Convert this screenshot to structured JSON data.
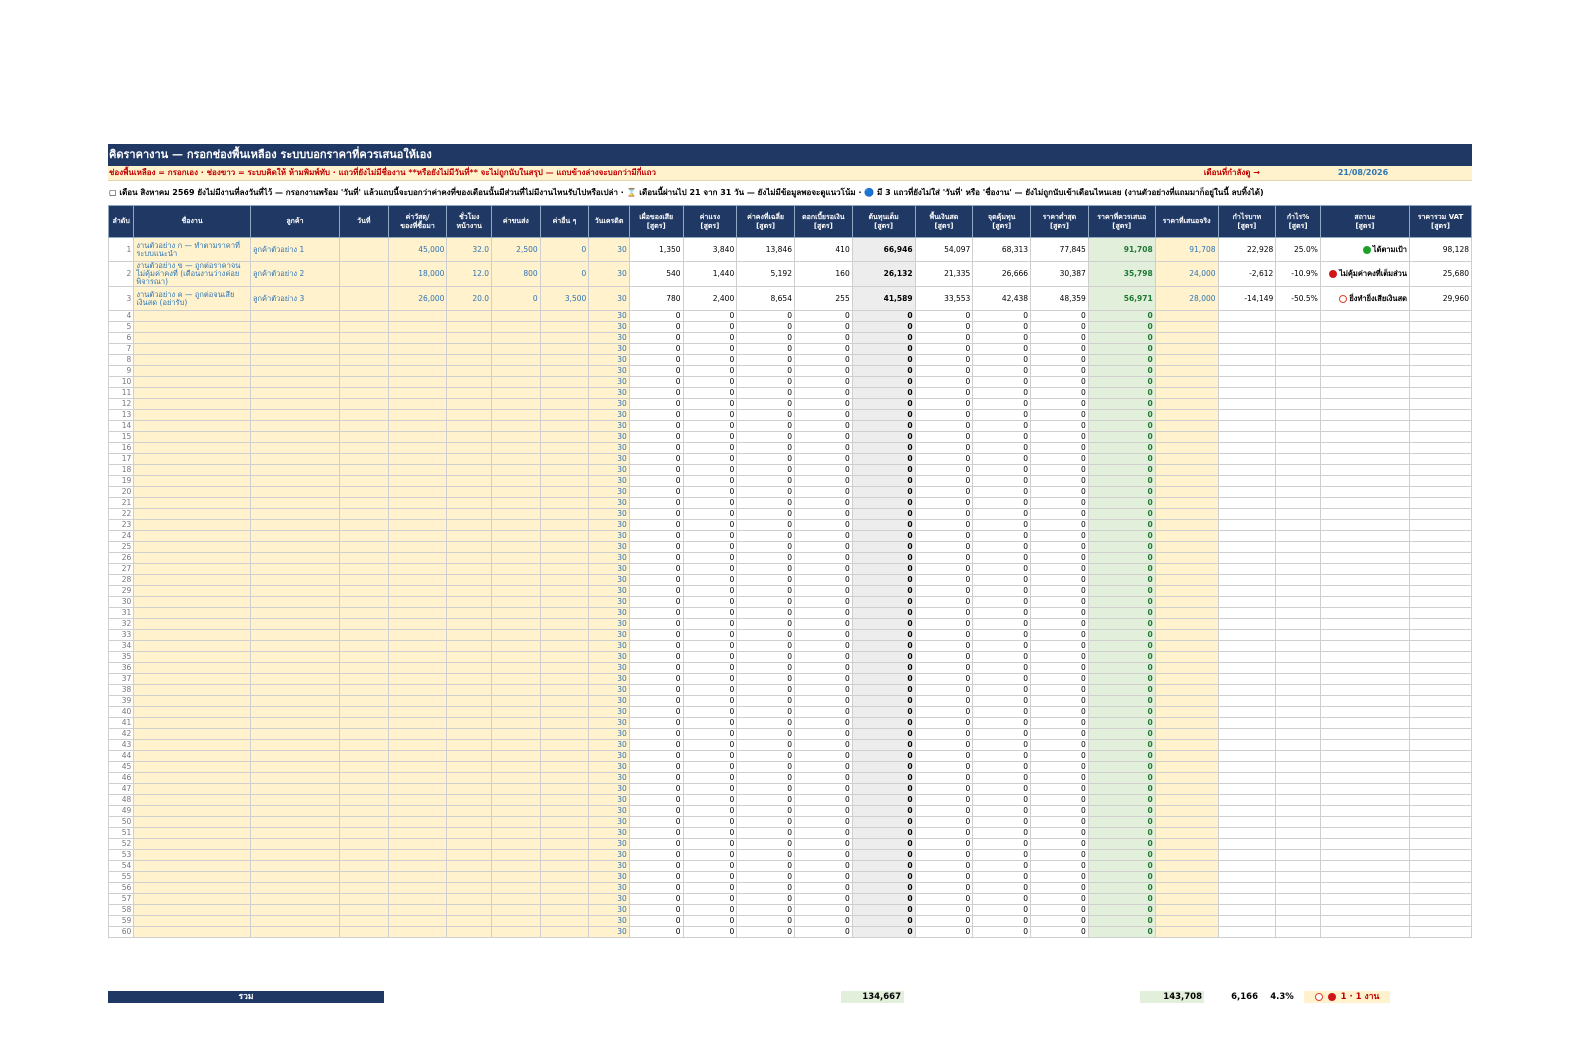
{
  "sheet": {
    "title": "คิดราคางาน — กรอกช่องพื้นเหลือง ระบบบอกราคาที่ควรเสนอให้เอง",
    "legend": "ช่องพื้นเหลือง = กรอกเอง · ช่องขาว = ระบบคิดให้ ห้ามพิมพ์ทับ · แถวที่ยังไม่มีชื่องาน **หรือยังไม่มีวันที่** จะไม่ถูกนับในสรุป — แถบข้างล่างจะบอกว่ามีกี่แถว",
    "month_label": "เดือนที่กำลังดู →",
    "month_value": "21/08/2026",
    "notice": "▢ เดือน สิงหาคม 2569 ยังไม่มีงานที่ลงวันที่ไว้ — กรอกงานพร้อม 'วันที่' แล้วแถบนี้จะบอกว่าค่าคงที่ของเดือนนั้นมีส่วนที่ไม่มีงานไหนรับไปหรือเปล่า · ⌛ เดือนนี้ผ่านไป 21 จาก 31 วัน — ยังไม่มีข้อมูลพอจะดูแนวโน้ม · 🔵 มี 3 แถวที่ยังไม่ใส่ 'วันที่' หรือ 'ชื่องาน' — ยังไม่ถูกนับเข้าเดือนไหนเลย (งานตัวอย่างที่แถมมาก็อยู่ในนี้ ลบทิ้งได้)"
  },
  "columns": [
    "ลำดับ",
    "ชื่องาน",
    "ลูกค้า",
    "วันที่",
    "ค่าวัสดุ/\nของที่ซื้อมา",
    "ชั่วโมง\nหน้างาน",
    "ค่าขนส่ง",
    "ค่าอื่น ๆ",
    "วันเครดิต",
    "เผื่อของเสีย\n[สูตร]",
    "ค่าแรง\n[สูตร]",
    "ค่าคงที่เฉลี่ย\n[สูตร]",
    "ดอกเบี้ยรอเงิน\n[สูตร]",
    "ต้นทุนเต็ม\n[สูตร]",
    "พื้นเงินสด\n[สูตร]",
    "จุดคุ้มทุน\n[สูตร]",
    "ราคาต่ำสุด\n[สูตร]",
    "ราคาที่ควรเสนอ\n[สูตร]",
    "ราคาที่เสนอจริง",
    "กำไรบาท\n[สูตร]",
    "กำไร%\n[สูตร]",
    "สถานะ\n[สูตร]",
    "ราคารวม VAT\n[สูตร]"
  ],
  "rows": [
    {
      "no": "1",
      "job": "งานตัวอย่าง ก — ทำตามราคาที่ระบบแนะนำ",
      "customer": "ลูกค้าตัวอย่าง 1",
      "date": "",
      "material": "45,000",
      "hours": "32.0",
      "shipping": "2,500",
      "other": "0",
      "credit": "30",
      "waste": "1,350",
      "labor": "3,840",
      "fixed": "13,846",
      "interest": "410",
      "fullcost": "66,946",
      "cashfloor": "54,097",
      "breakeven": "68,313",
      "minprice": "77,845",
      "suggested": "91,708",
      "actual": "91,708",
      "profit": "22,928",
      "pct": "25.0%",
      "status": "ได้ตามเป้า",
      "status_color": "g",
      "vat": "98,128"
    },
    {
      "no": "2",
      "job": "งานตัวอย่าง ข — ถูกต่อราคาจนไม่คุ้มค่าคงที่ (เดือนงานว่างค่อยพิจารณา)",
      "customer": "ลูกค้าตัวอย่าง 2",
      "date": "",
      "material": "18,000",
      "hours": "12.0",
      "shipping": "800",
      "other": "0",
      "credit": "30",
      "waste": "540",
      "labor": "1,440",
      "fixed": "5,192",
      "interest": "160",
      "fullcost": "26,132",
      "cashfloor": "21,335",
      "breakeven": "26,666",
      "minprice": "30,387",
      "suggested": "35,798",
      "actual": "24,000",
      "profit": "-2,612",
      "pct": "-10.9%",
      "status": "ไม่คุ้มค่าคงที่เต็มส่วน",
      "status_color": "r",
      "vat": "25,680"
    },
    {
      "no": "3",
      "job": "งานตัวอย่าง ค — ถูกต่อจนเสียเงินสด (อย่ารับ)",
      "customer": "ลูกค้าตัวอย่าง 3",
      "date": "",
      "material": "26,000",
      "hours": "20.0",
      "shipping": "0",
      "other": "3,500",
      "credit": "30",
      "waste": "780",
      "labor": "2,400",
      "fixed": "8,654",
      "interest": "255",
      "fullcost": "41,589",
      "cashfloor": "33,553",
      "breakeven": "42,438",
      "minprice": "48,359",
      "suggested": "56,971",
      "actual": "28,000",
      "profit": "-14,149",
      "pct": "-50.5%",
      "status": "ยิ่งทำยิ่งเสียเงินสด",
      "status_color": "o",
      "vat": "29,960"
    }
  ],
  "empty_rows": {
    "from": 4,
    "to": 60,
    "credit": "30",
    "zero": "0"
  },
  "totals": {
    "label": "รวม",
    "fullcost": "134,667",
    "quote": "143,708",
    "profit": "6,166",
    "pct": "4.3%",
    "status": "1 · 1 งาน"
  },
  "colors": {
    "header": "#1f3864",
    "input": "#fff2cc",
    "suggested": "#e2efda",
    "fullcost": "#ededed",
    "input_text": "#2e75b6"
  }
}
